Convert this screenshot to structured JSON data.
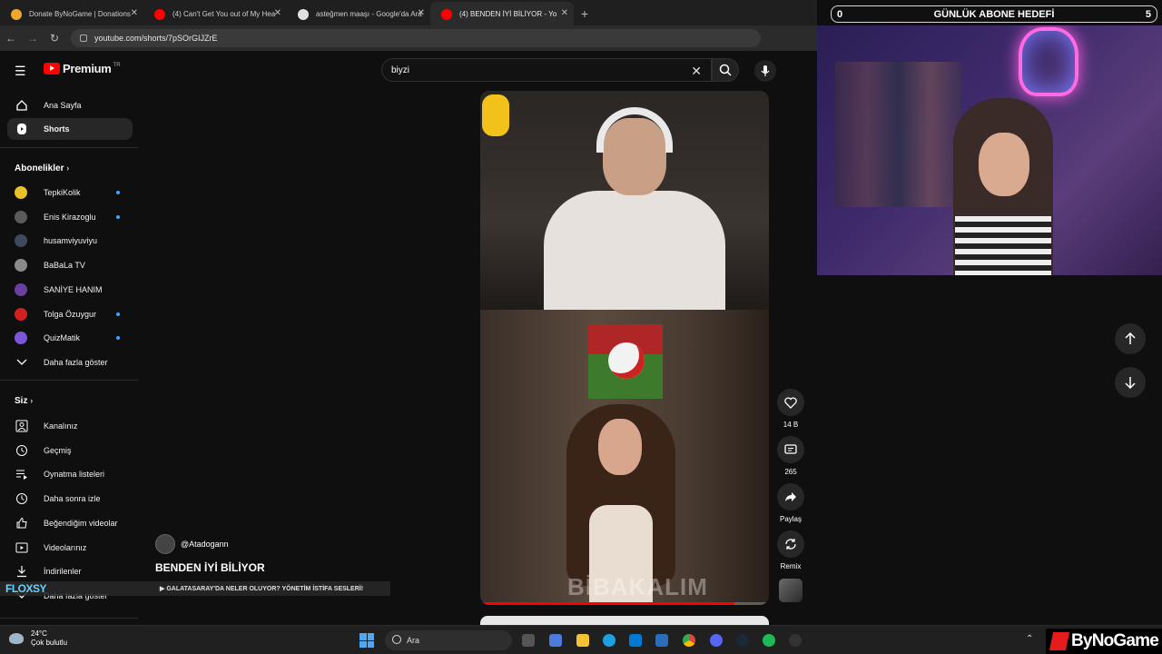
{
  "browser": {
    "tabs": [
      {
        "title": "Donate ByNoGame | Donations",
        "favicon_color": "#f0a830",
        "active": false
      },
      {
        "title": "(4) Can't Get You out of My Hea",
        "favicon_color": "#ff0000",
        "active": false
      },
      {
        "title": "asteğmen maaşı - Google'da Ara",
        "favicon_color": "#e0e0e0",
        "active": false
      },
      {
        "title": "(4) BENDEN İYİ BİLİYOR - Yo",
        "favicon_color": "#ff0000",
        "active": true
      }
    ],
    "new_tab": "+",
    "url": "youtube.com/shorts/7pSOrGIJZrE"
  },
  "overlay": {
    "sub_goal_count": "0",
    "sub_goal_label": "GÜNLÜK ABONE HEDEFİ",
    "sub_goal_target": "5"
  },
  "youtube": {
    "logo_text": "Premium",
    "logo_region": "TR",
    "search_value": "biyzi",
    "sidebar": {
      "main": [
        {
          "label": "Ana Sayfa",
          "icon": "home-icon"
        },
        {
          "label": "Shorts",
          "icon": "shorts-icon",
          "active": true
        }
      ],
      "subscriptions_header": "Abonelikler",
      "subscriptions": [
        {
          "label": "TepkiKolik",
          "color": "#e8c12c",
          "dot": true
        },
        {
          "label": "Enis Kirazoglu",
          "color": "#5a5a5a",
          "dot": true
        },
        {
          "label": "husamviyuviyu",
          "color": "#3c4a5c",
          "dot": false
        },
        {
          "label": "BaBaLa TV",
          "color": "#8a8a8a",
          "dot": false
        },
        {
          "label": "SANİYE HANIM",
          "color": "#6a3fa0",
          "dot": false
        },
        {
          "label": "Tolga Özuygur",
          "color": "#d02020",
          "dot": true
        },
        {
          "label": "QuizMatik",
          "color": "#7b56d8",
          "dot": true
        }
      ],
      "show_more": "Daha fazla göster",
      "you_header": "Siz",
      "you": [
        {
          "label": "Kanalınız",
          "icon": "user-icon"
        },
        {
          "label": "Geçmiş",
          "icon": "history-icon"
        },
        {
          "label": "Oynatma listeleri",
          "icon": "playlist-icon"
        },
        {
          "label": "Daha sonra izle",
          "icon": "clock-icon"
        },
        {
          "label": "Beğendiğim videolar",
          "icon": "thumbs-up-icon"
        },
        {
          "label": "Videolarınız",
          "icon": "video-icon"
        },
        {
          "label": "İndirilenler",
          "icon": "download-icon"
        },
        {
          "label": "Daha fazla göster",
          "icon": "chevron-down-icon"
        }
      ]
    },
    "short": {
      "channel": "@Atadogann",
      "title": "BENDEN İYİ BİLİYOR",
      "watermark": "BİBAKALIM",
      "progress": 0.88
    },
    "actions": {
      "likes": "14 B",
      "comments": "265",
      "share": "Paylaş",
      "remix": "Remix"
    }
  },
  "ticker": {
    "brand": "FLOXSY",
    "text": "▶ GALATASARAY'DA NELER OLUYOR? YÖNETİM İSTİFA SESLERİ!"
  },
  "taskbar": {
    "temperature": "24°C",
    "weather": "Çok bulutlu",
    "search_placeholder": "Ara",
    "brand": "ByNoGame"
  }
}
